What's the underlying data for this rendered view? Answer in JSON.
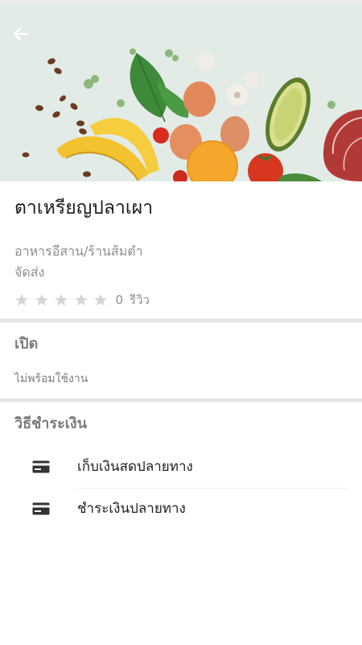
{
  "header": {
    "back_icon": "arrow-left-icon",
    "banner_image": "vegetables-and-fruits-photo"
  },
  "shop": {
    "name": "ตาเหรียญปลาเผา",
    "category": "อาหารอีสาน/ร้านส้มตำ",
    "delivery": "จัดส่ง",
    "rating": {
      "stars_filled": 0,
      "stars_total": 5,
      "count": "0",
      "label": "รีวิว"
    }
  },
  "hours": {
    "title": "เปิด",
    "status": "ไม่พร้อมใช้งาน"
  },
  "payment": {
    "title": "วิธีชำระเงิน",
    "methods": [
      {
        "label": "เก็บเงินสดปลายทาง",
        "icon": "credit-card-icon"
      },
      {
        "label": "ชำระเงินปลายทาง",
        "icon": "credit-card-icon"
      }
    ]
  },
  "colors": {
    "banner_bg": "#e3ebe7",
    "star_empty": "#d5d5d5",
    "muted_text": "#8d8d8d",
    "divider": "#e6e6e6"
  }
}
